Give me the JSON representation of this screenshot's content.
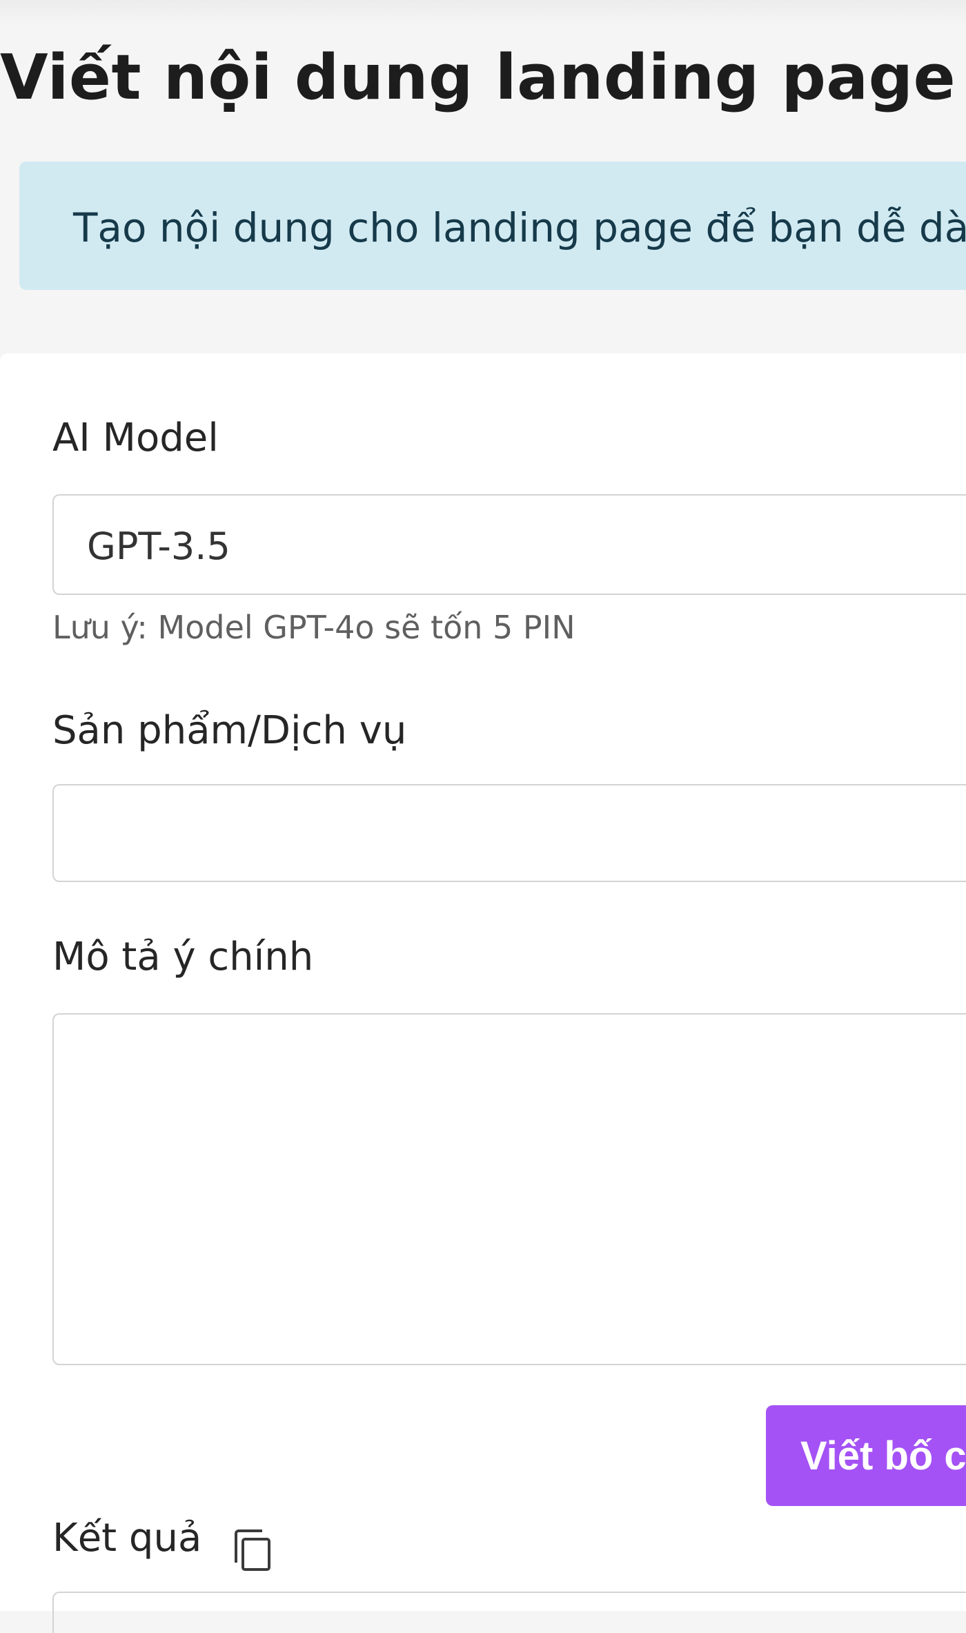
{
  "header": {
    "title": "Viết nội dung landing page"
  },
  "banner": {
    "text": "Tạo nội dung cho landing page để bạn dễ dàng"
  },
  "form": {
    "ai_model": {
      "label": "AI Model",
      "selected": "GPT-3.5",
      "note": "Lưu ý: Model GPT-4o sẽ tốn 5 PIN"
    },
    "product": {
      "label": "Sản phẩm/Dịch vụ",
      "value": ""
    },
    "description": {
      "label": "Mô tả ý chính",
      "value": ""
    },
    "submit_label": "Viết bố c"
  },
  "result": {
    "label": "Kết quả",
    "copy_icon": "copy-icon"
  },
  "colors": {
    "accent": "#a452f5",
    "banner_bg": "#d1eaf2",
    "page_bg": "#f5f5f5"
  }
}
